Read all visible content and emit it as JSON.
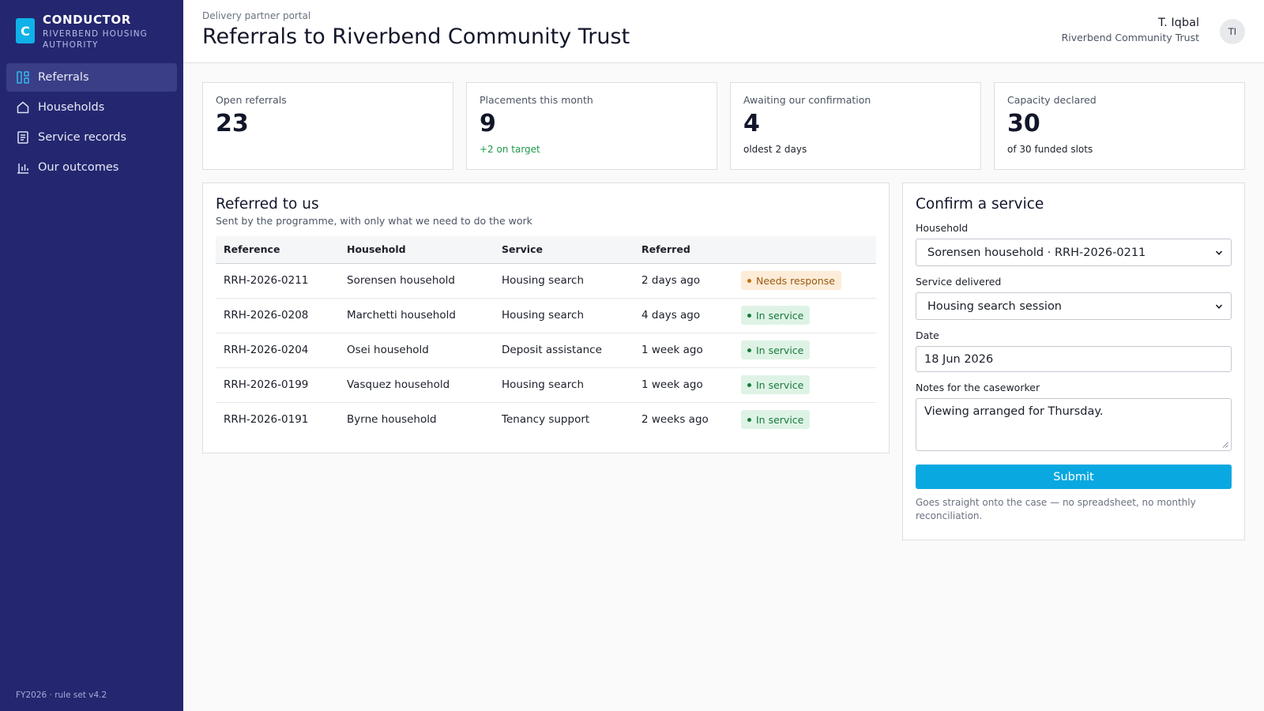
{
  "sidebar": {
    "logo_letter": "C",
    "brand_name": "CONDUCTOR",
    "brand_org": "RIVERBEND HOUSING AUTHORITY",
    "items": [
      {
        "label": "Referrals",
        "icon": "grid-icon",
        "active": true
      },
      {
        "label": "Households",
        "icon": "home-icon",
        "active": false
      },
      {
        "label": "Service records",
        "icon": "document-icon",
        "active": false
      },
      {
        "label": "Our outcomes",
        "icon": "bar-chart-icon",
        "active": false
      }
    ],
    "footer": "FY2026 · rule set v4.2"
  },
  "header": {
    "eyebrow": "Delivery partner portal",
    "title": "Referrals to Riverbend Community Trust",
    "user_name": "T. Iqbal",
    "user_org": "Riverbend Community Trust",
    "avatar_initials": "TI"
  },
  "stats": [
    {
      "label": "Open referrals",
      "value": "23",
      "sub": ""
    },
    {
      "label": "Placements this month",
      "value": "9",
      "sub": "+2 on target"
    },
    {
      "label": "Awaiting our confirmation",
      "value": "4",
      "sub": "oldest 2 days"
    },
    {
      "label": "Capacity declared",
      "value": "30",
      "sub": "of 30 funded slots"
    }
  ],
  "referrals": {
    "title": "Referred to us",
    "subtitle": "Sent by the programme, with only what we need to do the work",
    "columns": [
      "Reference",
      "Household",
      "Service",
      "Referred",
      ""
    ],
    "rows": [
      {
        "reference": "RRH-2026-0211",
        "household": "Sorensen household",
        "service": "Housing search",
        "referred": "2 days ago",
        "status": "Needs response"
      },
      {
        "reference": "RRH-2026-0208",
        "household": "Marchetti household",
        "service": "Housing search",
        "referred": "4 days ago",
        "status": "In service"
      },
      {
        "reference": "RRH-2026-0204",
        "household": "Osei household",
        "service": "Deposit assistance",
        "referred": "1 week ago",
        "status": "In service"
      },
      {
        "reference": "RRH-2026-0199",
        "household": "Vasquez household",
        "service": "Housing search",
        "referred": "1 week ago",
        "status": "In service"
      },
      {
        "reference": "RRH-2026-0191",
        "household": "Byrne household",
        "service": "Tenancy support",
        "referred": "2 weeks ago",
        "status": "In service"
      }
    ]
  },
  "confirm": {
    "title": "Confirm a service",
    "household_label": "Household",
    "household_value": "Sorensen household · RRH-2026-0211",
    "service_label": "Service delivered",
    "service_value": "Housing search session",
    "date_label": "Date",
    "date_value": "18 Jun 2026",
    "notes_label": "Notes for the caseworker",
    "notes_value": "Viewing arranged for Thursday.",
    "submit_label": "Submit",
    "hint": "Goes straight onto the case — no spreadsheet, no monthly reconciliation."
  },
  "colors": {
    "sidebar_bg": "#24276f",
    "accent": "#0aa8e0",
    "warn_badge_bg": "#fdecd7",
    "ok_badge_bg": "#def3e5",
    "positive_text": "#1f9a4a"
  }
}
